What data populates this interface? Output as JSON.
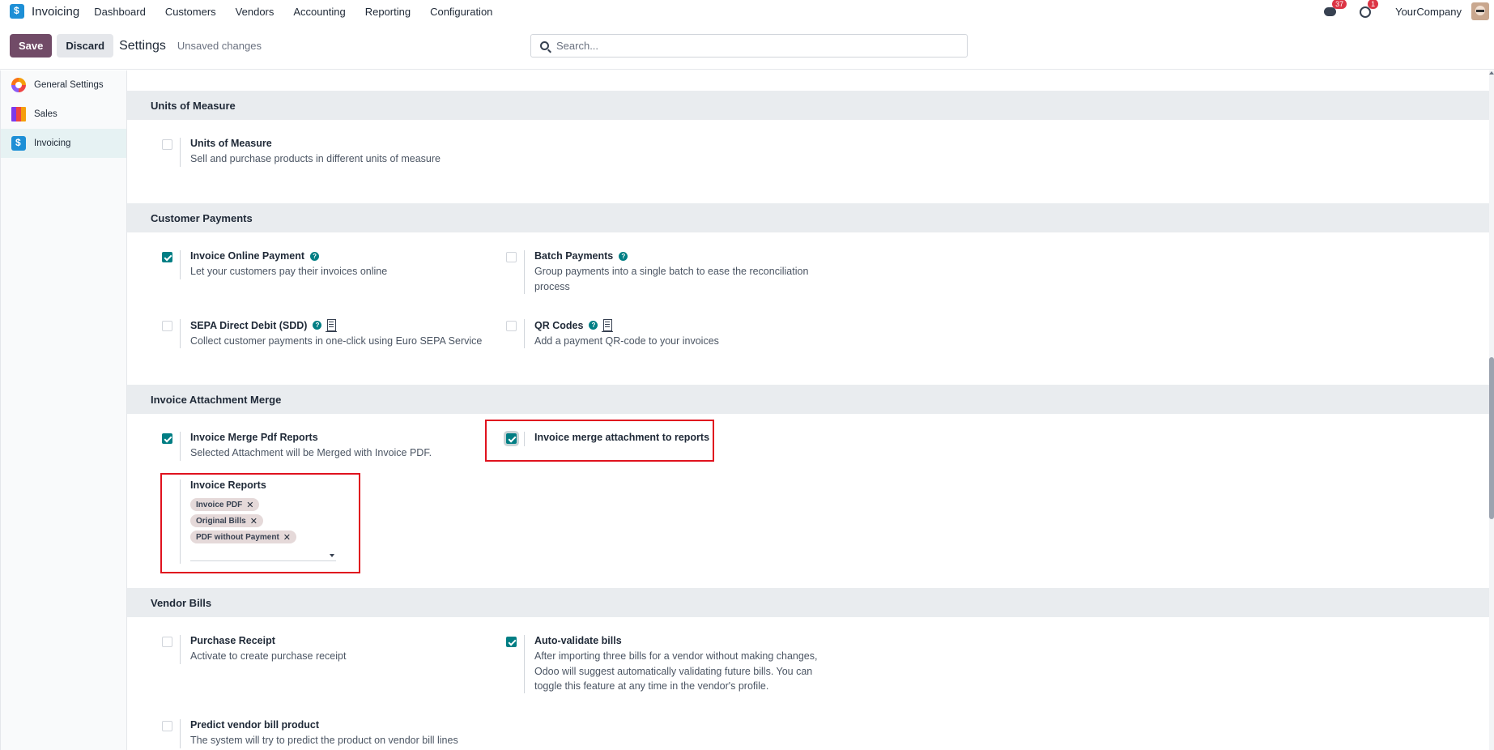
{
  "app": {
    "name": "Invoicing"
  },
  "menu": [
    "Dashboard",
    "Customers",
    "Vendors",
    "Accounting",
    "Reporting",
    "Configuration"
  ],
  "systray": {
    "messages_count": "37",
    "activities_count": "1",
    "company": "YourCompany"
  },
  "control": {
    "save_label": "Save",
    "discard_label": "Discard",
    "title": "Settings",
    "status": "Unsaved changes",
    "search_placeholder": "Search..."
  },
  "sidebar": {
    "items": [
      {
        "label": "General Settings",
        "icon": "general-settings-icon"
      },
      {
        "label": "Sales",
        "icon": "sales-icon"
      },
      {
        "label": "Invoicing",
        "icon": "invoicing-icon",
        "active": true
      }
    ]
  },
  "sections": {
    "uom": {
      "title": "Units of Measure",
      "uom_setting": {
        "title": "Units of Measure",
        "desc": "Sell and purchase products in different units of measure",
        "checked": false
      }
    },
    "payments": {
      "title": "Customer Payments",
      "online": {
        "title": "Invoice Online Payment",
        "desc": "Let your customers pay their invoices online",
        "checked": true
      },
      "batch": {
        "title": "Batch Payments",
        "desc": "Group payments into a single batch to ease the reconciliation process",
        "checked": false
      },
      "sepa": {
        "title": "SEPA Direct Debit (SDD)",
        "desc": "Collect customer payments in one-click using Euro SEPA Service",
        "checked": false
      },
      "qr": {
        "title": "QR Codes",
        "desc": "Add a payment QR-code to your invoices",
        "checked": false
      }
    },
    "merge": {
      "title": "Invoice Attachment Merge",
      "pdf": {
        "title": "Invoice Merge Pdf Reports",
        "desc": "Selected Attachment will be Merged with Invoice PDF.",
        "checked": true
      },
      "attach": {
        "title": "Invoice merge attachment to reports",
        "checked": true
      },
      "reports": {
        "title": "Invoice Reports",
        "tags": [
          "Invoice PDF",
          "Original Bills",
          "PDF without Payment"
        ]
      }
    },
    "vendor": {
      "title": "Vendor Bills",
      "receipt": {
        "title": "Purchase Receipt",
        "desc": "Activate to create purchase receipt",
        "checked": false
      },
      "autovalidate": {
        "title": "Auto-validate bills",
        "desc": "After importing three bills for a vendor without making changes, Odoo will suggest automatically validating future bills. You can toggle this feature at any time in the vendor's profile.",
        "checked": true
      },
      "predict": {
        "title": "Predict vendor bill product",
        "desc": "The system will try to predict the product on vendor bill lines",
        "checked": false
      }
    }
  },
  "colors": {
    "brand": "#714b67",
    "accent": "#017e84",
    "highlight": "#e0121e"
  }
}
